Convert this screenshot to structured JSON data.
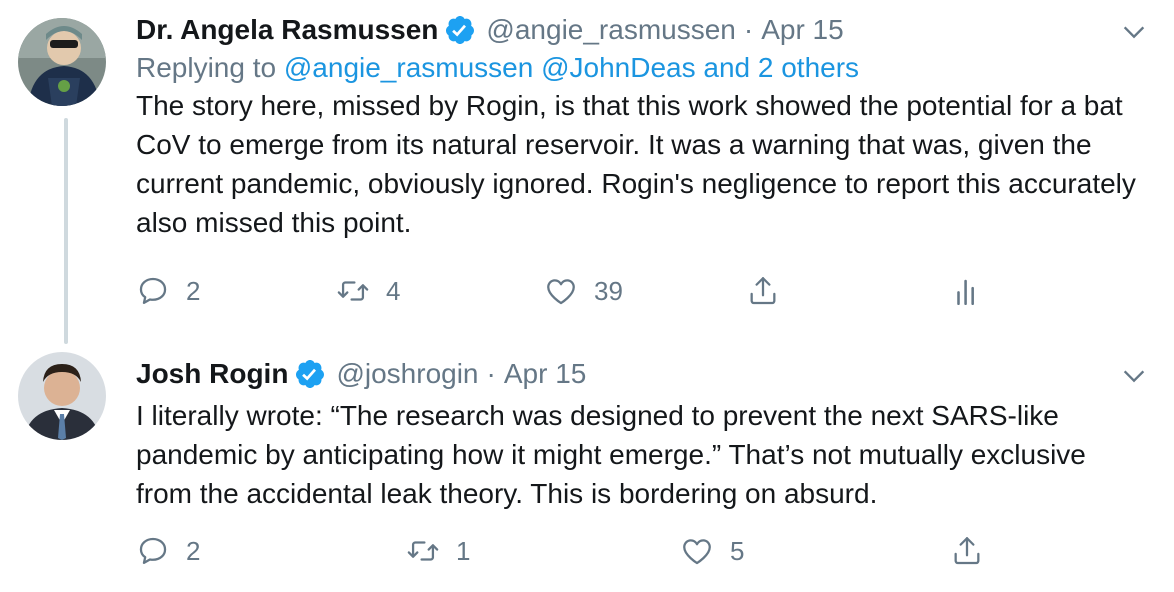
{
  "tweets": [
    {
      "author_name": "Dr. Angela Rasmussen",
      "handle": "@angie_rasmussen",
      "separator": "·",
      "date": "Apr 15",
      "replying_prefix": "Replying to",
      "reply_mentions": "@angie_rasmussen @JohnDeas and 2 others",
      "text": "The story here, missed by Rogin, is that this work showed the potential for a bat CoV to emerge from its natural reservoir. It was a warning that was, given the current pandemic, obviously ignored. Rogin's negligence to report this accurately also missed this point.",
      "replies": "2",
      "retweets": "4",
      "likes": "39"
    },
    {
      "author_name": "Josh Rogin",
      "handle": "@joshrogin",
      "separator": "·",
      "date": "Apr 15",
      "text": "I literally wrote: “The research was designed to prevent the next SARS-like pandemic by anticipating how it might emerge.” That’s not mutually exclusive from the accidental leak theory. This is bordering on absurd.",
      "replies": "2",
      "retweets": "1",
      "likes": "5"
    }
  ],
  "colors": {
    "verified": "#1da1f2",
    "link": "#1b95e0",
    "muted": "#657786",
    "thread_line": "#cfd9de"
  },
  "icons": [
    "reply-icon",
    "retweet-icon",
    "like-icon",
    "share-icon",
    "analytics-icon",
    "caret-down-icon",
    "verified-badge-icon"
  ]
}
